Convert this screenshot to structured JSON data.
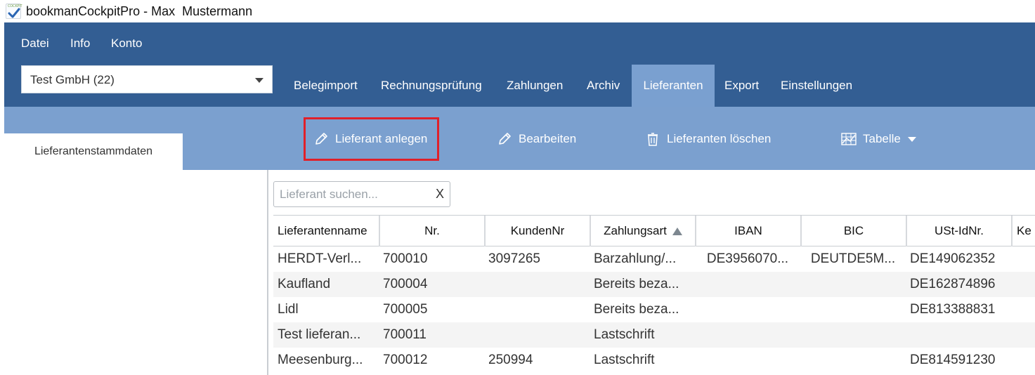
{
  "window": {
    "title": "bookmanCockpitPro - Max  Mustermann",
    "logo_text": "COCKPIT"
  },
  "menu": [
    {
      "label": "Datei"
    },
    {
      "label": "Info"
    },
    {
      "label": "Konto"
    }
  ],
  "company_select": {
    "value": "Test GmbH (22)"
  },
  "nav_tabs": [
    {
      "label": "Belegimport"
    },
    {
      "label": "Rechnungsprüfung"
    },
    {
      "label": "Zahlungen"
    },
    {
      "label": "Archiv"
    },
    {
      "label": "Lieferanten",
      "active": true
    },
    {
      "label": "Export"
    },
    {
      "label": "Einstellungen"
    }
  ],
  "side_tab": {
    "label": "Lieferantenstammdaten"
  },
  "toolbar": {
    "create_label": "Lieferant anlegen",
    "edit_label": "Bearbeiten",
    "delete_label": "Lieferanten löschen",
    "table_label": "Tabelle"
  },
  "search": {
    "placeholder": "Lieferant suchen...",
    "clear": "X"
  },
  "table": {
    "columns": [
      "Lieferantenname",
      "Nr.",
      "KundenNr",
      "Zahlungsart",
      "IBAN",
      "BIC",
      "USt-IdNr.",
      "Ke"
    ],
    "sort_column": "Zahlungsart",
    "rows": [
      [
        "HERDT-Verl...",
        "700010",
        "3097265",
        "Barzahlung/...",
        "DE3956070...",
        "DEUTDE5M...",
        "DE149062352",
        ""
      ],
      [
        "Kaufland",
        "700004",
        "",
        "Bereits beza...",
        "",
        "",
        "DE162874896",
        ""
      ],
      [
        "Lidl",
        "700005",
        "",
        "Bereits beza...",
        "",
        "",
        "DE813388831",
        ""
      ],
      [
        "Test lieferan...",
        "700011",
        "",
        "Lastschrift",
        "",
        "",
        "",
        ""
      ],
      [
        "Meesenburg...",
        "700012",
        "250994",
        "Lastschrift",
        "",
        "",
        "DE814591230",
        ""
      ]
    ]
  },
  "colors": {
    "header": "#335e93",
    "toolbar": "#7ba0cf",
    "highlight": "#e0202a"
  },
  "icons": {
    "create": "pencil-icon",
    "edit": "pencil-icon",
    "delete": "trash-icon",
    "table": "table-chart-icon"
  }
}
